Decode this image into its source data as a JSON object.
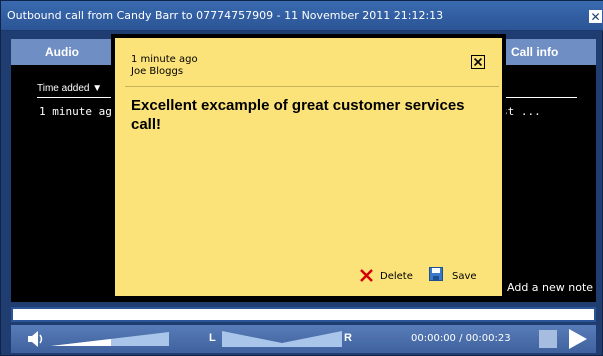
{
  "window": {
    "title": "Outbound call from Candy Barr to 07774757909 - 11 November 2011 21:12:13",
    "close_symbol": "✕"
  },
  "tabs": [
    {
      "label": "Audio"
    },
    {
      "label": "Call info"
    }
  ],
  "notes_list": {
    "column_header": "Time added ▼",
    "rows": [
      {
        "time_added": "1 minute ag",
        "text_preview": "st ..."
      }
    ],
    "add_note_label": "Add a new note"
  },
  "note_popup": {
    "time": "1 minute ago",
    "author": "Joe Bloggs",
    "body": "Excellent excample of great customer services call!",
    "delete_label": "Delete",
    "save_label": "Save"
  },
  "player": {
    "balance_left": "L",
    "balance_right": "R",
    "time_display": "00:00:00 / 00:00:23",
    "icons": [
      "speaker-icon",
      "stop-icon",
      "play-icon"
    ]
  },
  "colors": {
    "window_bg": "#1f3d70",
    "titlebar": "#2b5596",
    "tabbar": "#6f8fc4",
    "note_bg": "#fbe37a",
    "delete_red": "#d40000",
    "save_blue": "#3a78c8"
  }
}
